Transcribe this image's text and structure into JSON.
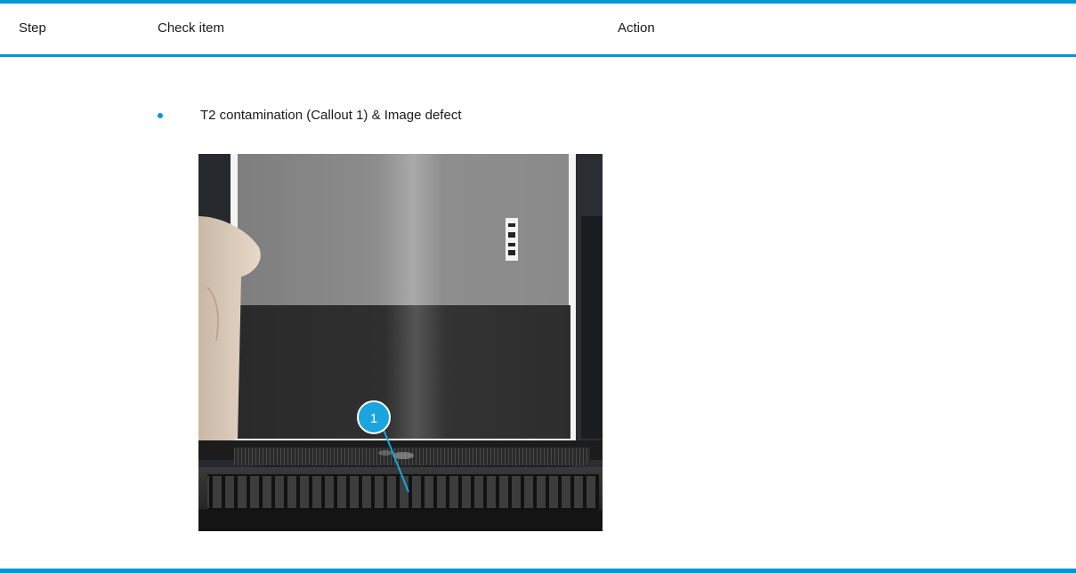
{
  "table": {
    "headers": {
      "step": "Step",
      "check_item": "Check item",
      "action": "Action"
    },
    "row": {
      "bullet_text": "T2 contamination (Callout 1) & Image defect",
      "figure": {
        "callout_label": "1"
      }
    }
  },
  "colors": {
    "accent": "#0096d6",
    "text": "#1a1a1a",
    "background": "#ffffff"
  },
  "icons": {
    "bullet": "bullet-dot-icon"
  }
}
